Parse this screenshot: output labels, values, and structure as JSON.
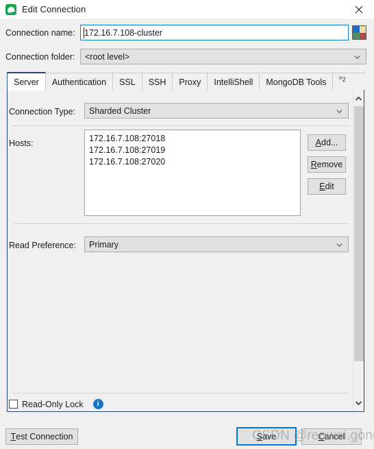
{
  "window": {
    "title": "Edit Connection",
    "app_icon": "mongo-leaf-icon",
    "close_icon": "close-icon"
  },
  "form": {
    "connection_name_label": "Connection name:",
    "connection_name_value": "172.16.7.108-cluster",
    "connection_name_placeholder": "",
    "connection_folder_label": "Connection folder:",
    "connection_folder_value": "<root level>",
    "color_swatch": {
      "name": "color-swatch-icon",
      "top_left": "#1f6fc0",
      "top_right": "#f2d7a0",
      "bottom_left": "#4f8f63",
      "bottom_right": "#b24a4f"
    }
  },
  "tabs": [
    {
      "label": "Server",
      "active": true
    },
    {
      "label": "Authentication",
      "active": false
    },
    {
      "label": "SSL",
      "active": false
    },
    {
      "label": "SSH",
      "active": false
    },
    {
      "label": "Proxy",
      "active": false
    },
    {
      "label": "IntelliShell",
      "active": false
    },
    {
      "label": "MongoDB Tools",
      "active": false
    }
  ],
  "tab_overflow": {
    "glyph": "»",
    "count": "2"
  },
  "server_tab": {
    "connection_type_label": "Connection Type:",
    "connection_type_value": "Sharded Cluster",
    "hosts_label": "Hosts:",
    "hosts": [
      "172.16.7.108:27018",
      "172.16.7.108:27019",
      "172.16.7.108:27020"
    ],
    "buttons": {
      "add": {
        "mnemonic": "A",
        "rest": "dd..."
      },
      "remove": {
        "mnemonic": "R",
        "rest": "emove"
      },
      "edit": {
        "mnemonic": "E",
        "rest": "dit"
      }
    },
    "read_preference_label": "Read Preference:",
    "read_preference_value": "Primary",
    "read_only_lock_label": "Read-Only Lock",
    "read_only_lock_checked": false,
    "info_icon_glyph": "i"
  },
  "footer": {
    "test_connection": {
      "mnemonic": "T",
      "rest": "est Connection"
    },
    "save": {
      "mnemonic": "S",
      "pre": "",
      "rest": "ave",
      "default": true
    },
    "cancel": {
      "mnemonic": "C",
      "rest": "ancel"
    }
  },
  "watermark": {
    "text": "CSDN @renwei.gong"
  }
}
